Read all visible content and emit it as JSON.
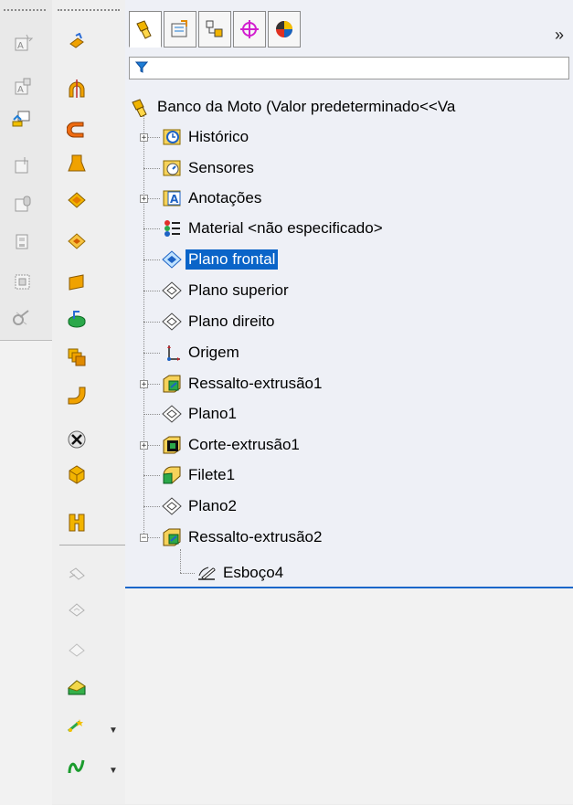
{
  "window": {
    "expand_glyph": "»"
  },
  "manager_tabs": [
    {
      "name": "featuremanager-tab"
    },
    {
      "name": "propertymanager-tab"
    },
    {
      "name": "configurationmanager-tab"
    },
    {
      "name": "dimxpert-tab"
    },
    {
      "name": "display-manager-tab"
    }
  ],
  "tree": {
    "root": "Banco da Moto  (Valor predeterminado<<Va",
    "items": [
      {
        "label": "Histórico",
        "icon": "history-icon",
        "expander": "+"
      },
      {
        "label": "Sensores",
        "icon": "sensor-icon",
        "expander": ""
      },
      {
        "label": "Anotações",
        "icon": "annotations-icon",
        "expander": "+"
      },
      {
        "label": "Material <não especificado>",
        "icon": "material-icon",
        "expander": ""
      },
      {
        "label": "Plano frontal",
        "icon": "plane-icon",
        "expander": "",
        "selected": true
      },
      {
        "label": "Plano superior",
        "icon": "plane-icon",
        "expander": ""
      },
      {
        "label": "Plano direito",
        "icon": "plane-icon",
        "expander": ""
      },
      {
        "label": "Origem",
        "icon": "origin-icon",
        "expander": ""
      },
      {
        "label": "Ressalto-extrusão1",
        "icon": "boss-extrude-icon",
        "expander": "+"
      },
      {
        "label": "Plano1",
        "icon": "plane-icon",
        "expander": ""
      },
      {
        "label": "Corte-extrusão1",
        "icon": "cut-extrude-icon",
        "expander": "+"
      },
      {
        "label": "Filete1",
        "icon": "fillet-icon",
        "expander": ""
      },
      {
        "label": "Plano2",
        "icon": "plane-icon",
        "expander": ""
      },
      {
        "label": "Ressalto-extrusão2",
        "icon": "boss-extrude-icon",
        "expander": "−"
      }
    ],
    "child": {
      "label": "Esboço4",
      "icon": "sketch-icon"
    }
  },
  "colors": {
    "selection": "#0a64c8",
    "rollback_bar": "#1a66c9",
    "panel_bg": "#eef0f6"
  }
}
